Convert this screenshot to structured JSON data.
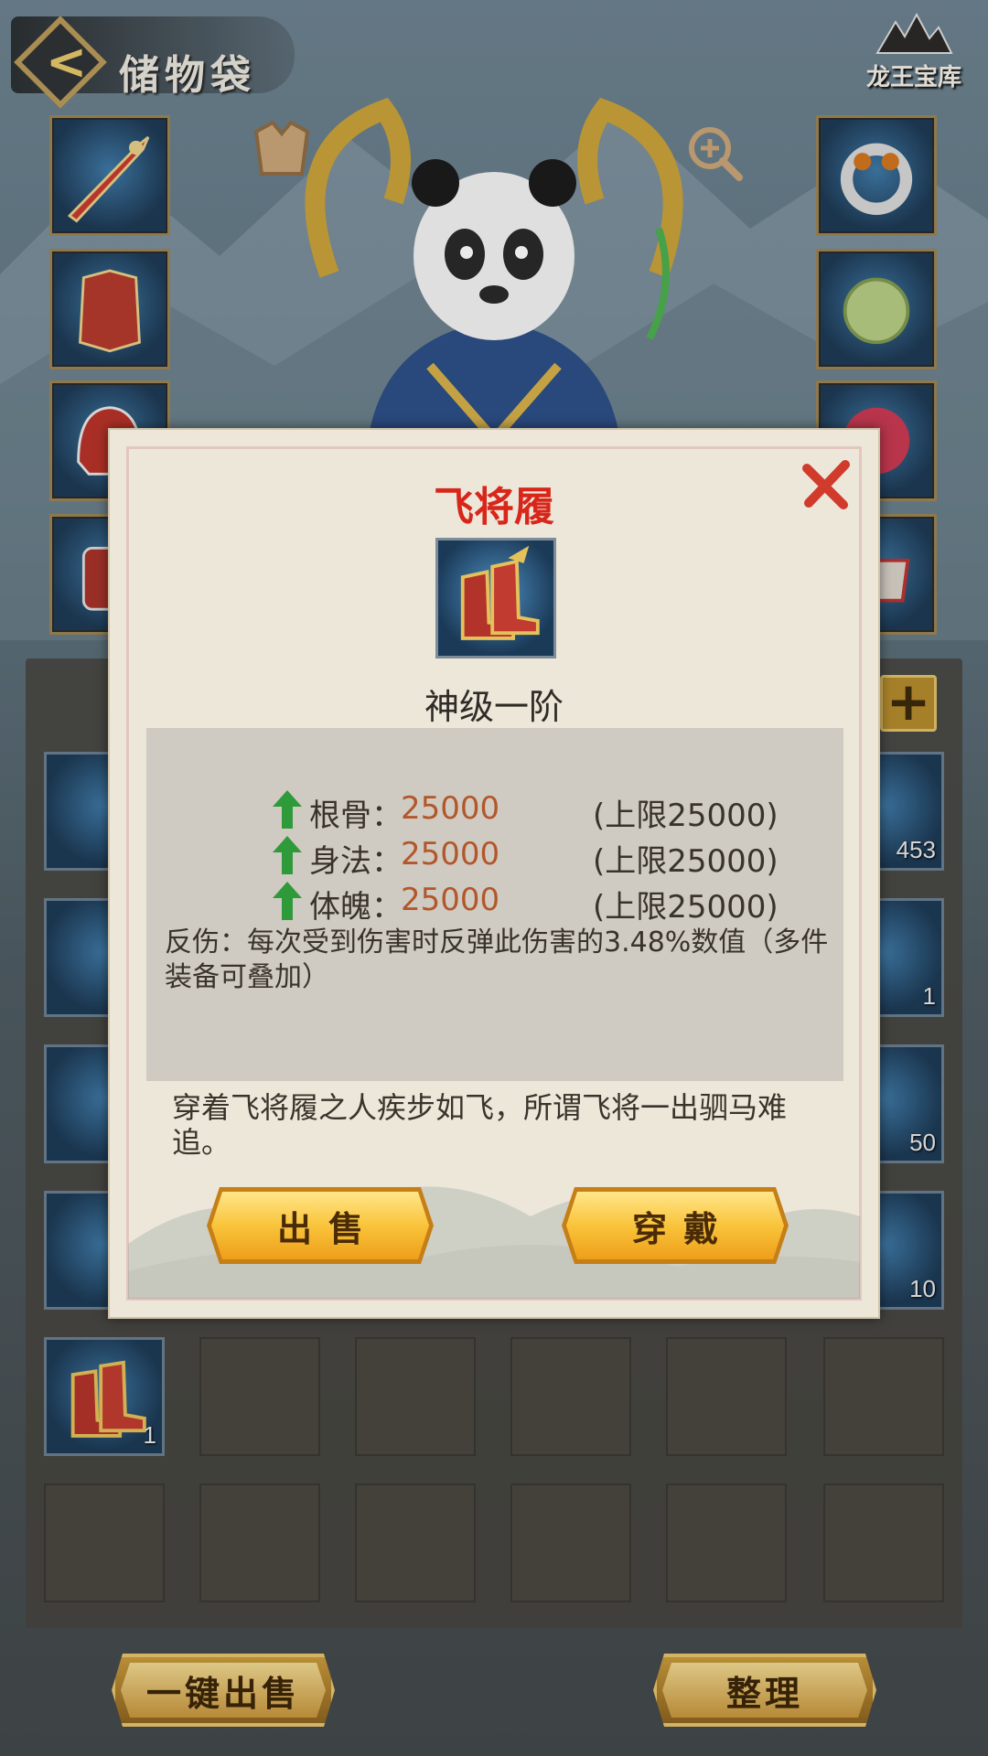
{
  "header": {
    "title": "储物袋",
    "treasury_label": "龙王宝库"
  },
  "equipment": {
    "left_slots": [
      "sword-icon",
      "chest-armor-icon",
      "helmet-icon",
      "gauntlet-icon"
    ],
    "right_slots": [
      "ring-icon",
      "jade-pendant-icon",
      "bead-icon",
      "belt-icon"
    ]
  },
  "bag": {
    "counts": {
      "row1_last": "453",
      "row2_last": "1",
      "row3_last": "50",
      "row4_last": "10",
      "row5_first": "1"
    }
  },
  "modal": {
    "title": "飞将履",
    "grade": "神级一阶",
    "stats": [
      {
        "name": "根骨：",
        "value": "25000",
        "cap": "(上限25000)"
      },
      {
        "name": "身法：",
        "value": "25000",
        "cap": "(上限25000)"
      },
      {
        "name": "体魄：",
        "value": "25000",
        "cap": "(上限25000)"
      }
    ],
    "effect": "反伤：每次受到伤害时反弹此伤害的3.48%数值（多件装备可叠加）",
    "flavor": "穿着飞将履之人疾步如飞，所谓飞将一出驷马难追。",
    "sell_label": "出售",
    "equip_label": "穿戴"
  },
  "footer": {
    "sell_all_label": "一键出售",
    "sort_label": "整理"
  },
  "colors": {
    "title_red": "#d8261b",
    "stat_value": "#b2572a",
    "arrow_green": "#2f9a3a"
  }
}
